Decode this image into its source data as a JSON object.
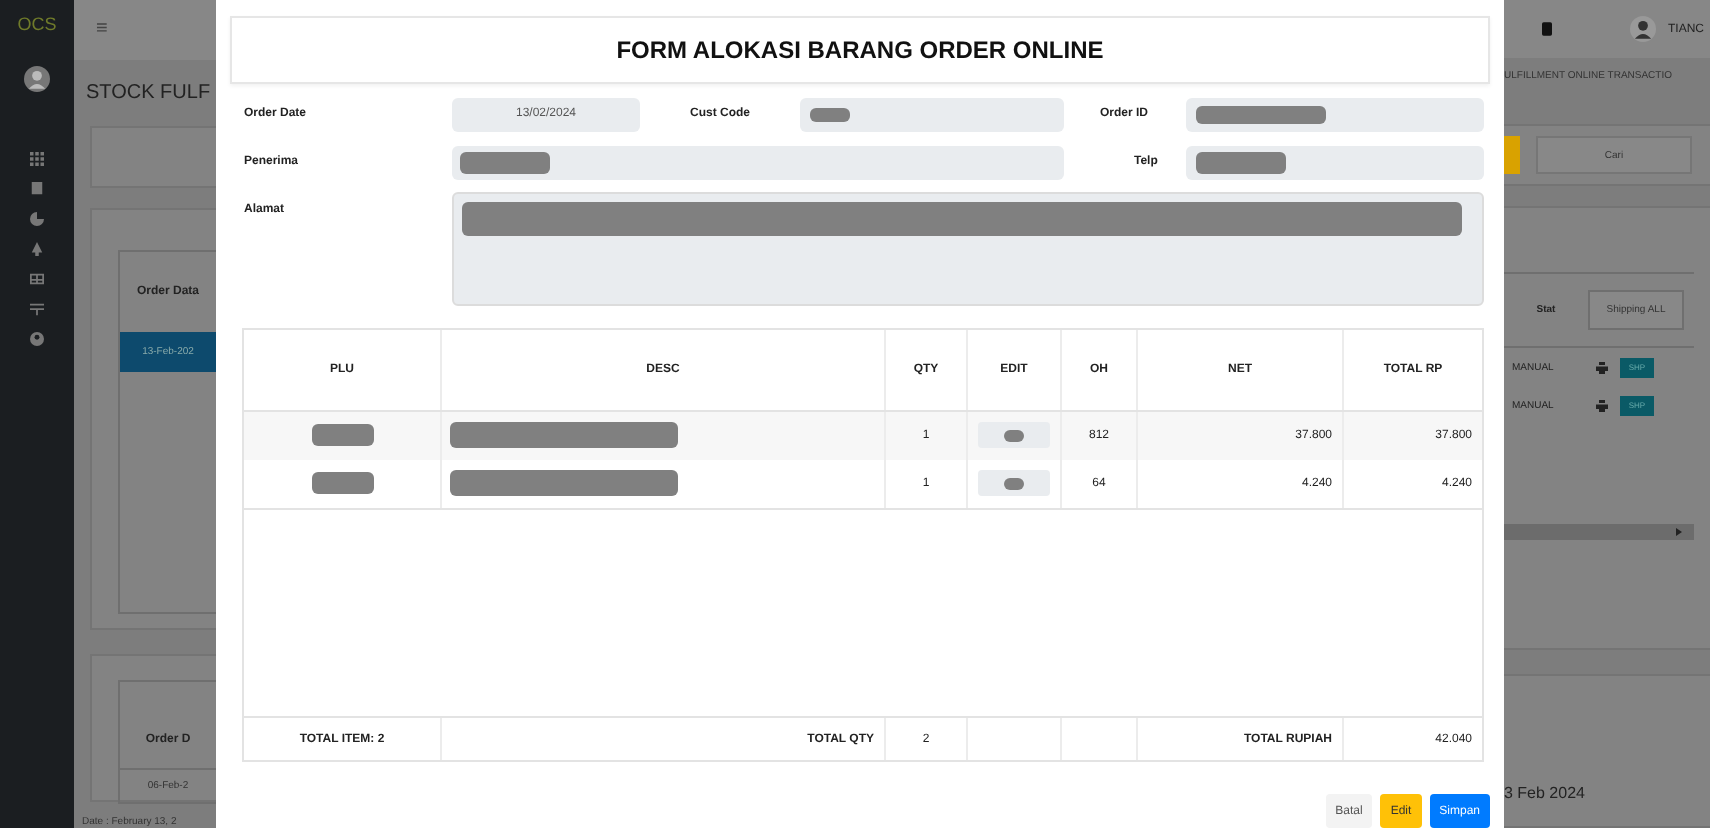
{
  "sidebar": {
    "logo": "OCS"
  },
  "background": {
    "menu_icon": "≡",
    "page_title": "STOCK FULF",
    "breadcrumb": "ULFILLMENT ONLINE TRANSACTIO",
    "user": "TIANC",
    "search_button": "Cari",
    "order_header": "Order Data",
    "selected_date": "13-Feb-202",
    "status_header": "Stat",
    "shipping_filter": "Shipping ALL",
    "rows": [
      {
        "type": "MANUAL",
        "action": "SHP"
      },
      {
        "type": "MANUAL",
        "action": "SHP"
      }
    ],
    "second_order_header": "Order D",
    "second_date": "06-Feb-2",
    "right_date": "3 Feb 2024",
    "footer_date": "Date : February 13, 2"
  },
  "modal": {
    "title": "FORM ALOKASI BARANG ORDER ONLINE",
    "fields": [
      {
        "label": "Order Date",
        "value": "13/02/2024",
        "redacted": false
      },
      {
        "label": "Cust Code",
        "redacted": true
      },
      {
        "label": "Order ID",
        "redacted": true
      },
      {
        "label": "Penerima",
        "redacted": true
      },
      {
        "label": "Telp",
        "redacted": true
      },
      {
        "label": "Alamat",
        "redacted": true
      }
    ],
    "table": {
      "columns": [
        "PLU",
        "DESC",
        "QTY",
        "EDIT",
        "OH",
        "NET",
        "TOTAL RP"
      ],
      "rows": [
        {
          "qty": "1",
          "oh": "812",
          "net": "37.800",
          "total_rp": "37.800"
        },
        {
          "qty": "1",
          "oh": "64",
          "net": "4.240",
          "total_rp": "4.240"
        }
      ],
      "footer": {
        "items_label": "TOTAL ITEM: 2",
        "qty_label": "TOTAL QTY",
        "qty": "2",
        "rupiah_label": "TOTAL RUPIAH",
        "rupiah": "42.040"
      }
    },
    "buttons": [
      {
        "label": "Batal",
        "kind": "secondary"
      },
      {
        "label": "Edit",
        "kind": "warning"
      },
      {
        "label": "Simpan",
        "kind": "primary"
      }
    ]
  }
}
